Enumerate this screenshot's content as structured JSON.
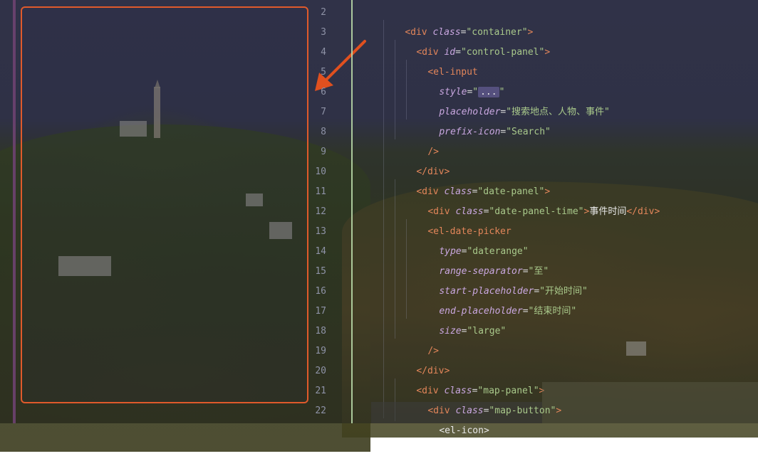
{
  "gutter": {
    "line_numbers": [
      "2",
      "3",
      "4",
      "5",
      "6",
      "7",
      "8",
      "9",
      "10",
      "11",
      "12",
      "13",
      "14",
      "15",
      "16",
      "17",
      "18",
      "19",
      "20",
      "21",
      "22"
    ]
  },
  "code": {
    "l2": {
      "open": "<div",
      "attr": "class",
      "val": "\"container\"",
      "close": ">"
    },
    "l3": {
      "open": "<div",
      "attr": "id",
      "val": "\"control-panel\"",
      "close": ">"
    },
    "l4": {
      "open": "<el-input"
    },
    "l5": {
      "attr": "style",
      "q1": "\"",
      "dots": "...",
      "q2": "\""
    },
    "l6": {
      "attr": "placeholder",
      "val": "\"搜索地点、人物、事件\""
    },
    "l7": {
      "attr": "prefix-icon",
      "val": "\"Search\""
    },
    "l8": {
      "close": "/>"
    },
    "l9": {
      "close": "</div>"
    },
    "l10": {
      "open": "<div",
      "attr": "class",
      "val": "\"date-panel\"",
      "close": ">"
    },
    "l11": {
      "open": "<div",
      "attr": "class",
      "val": "\"date-panel-time\"",
      "close": ">",
      "text": "事件时间",
      "end": "</div>"
    },
    "l12": {
      "open": "<el-date-picker"
    },
    "l13": {
      "attr": "type",
      "val": "\"daterange\""
    },
    "l14": {
      "attr": "range-separator",
      "val": "\"至\""
    },
    "l15": {
      "attr": "start-placeholder",
      "val": "\"开始时间\""
    },
    "l16": {
      "attr": "end-placeholder",
      "val": "\"结束时间\""
    },
    "l17": {
      "attr": "size",
      "val": "\"large\""
    },
    "l18": {
      "close": "/>"
    },
    "l19": {
      "close": "</div>"
    },
    "l20": {
      "open": "<div",
      "attr": "class",
      "val": "\"map-panel\"",
      "close": ">"
    },
    "l21": {
      "open": "<div",
      "attr": "class",
      "val": "\"map-button\"",
      "close": ">"
    },
    "l22": {
      "open": "<el-icon",
      "close": ">"
    }
  },
  "colors": {
    "highlight_border": "#e05a2b",
    "arrow": "#e0501f",
    "tag": "#e3865a",
    "attr": "#c9a7e0",
    "string": "#a9c98b"
  }
}
